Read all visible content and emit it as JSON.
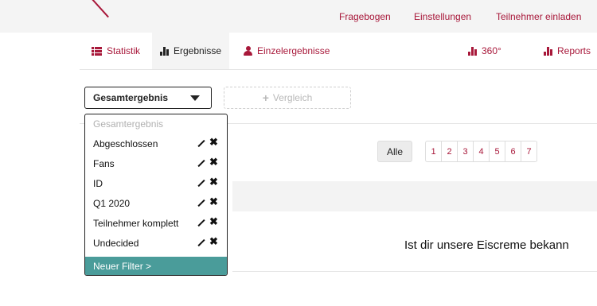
{
  "topnav": {
    "items": [
      "Fragebogen",
      "Einstellungen",
      "Teilnehmer einladen"
    ]
  },
  "subnav": {
    "statistik": "Statistik",
    "ergebnisse": "Ergebnisse",
    "einzelergebnisse": "Einzelergebnisse",
    "r360": "360°",
    "reports": "Reports"
  },
  "filter": {
    "selected": "Gesamtergebnis",
    "compare": "Vergleich",
    "options": [
      {
        "label": "Gesamtergebnis",
        "editable": false
      },
      {
        "label": "Abgeschlossen",
        "editable": true
      },
      {
        "label": "Fans",
        "editable": true
      },
      {
        "label": "ID",
        "editable": true
      },
      {
        "label": "Q1 2020",
        "editable": true
      },
      {
        "label": "Teilnehmer komplett",
        "editable": true
      },
      {
        "label": "Undecided",
        "editable": true
      }
    ],
    "new_filter": "Neuer Filter >"
  },
  "pagination": {
    "all": "Alle",
    "pages": [
      "1",
      "2",
      "3",
      "4",
      "5",
      "6",
      "7"
    ]
  },
  "question": "Ist dir unsere Eiscreme bekann",
  "colors": {
    "accent": "#a8183a",
    "footer": "#4a9c9a"
  }
}
